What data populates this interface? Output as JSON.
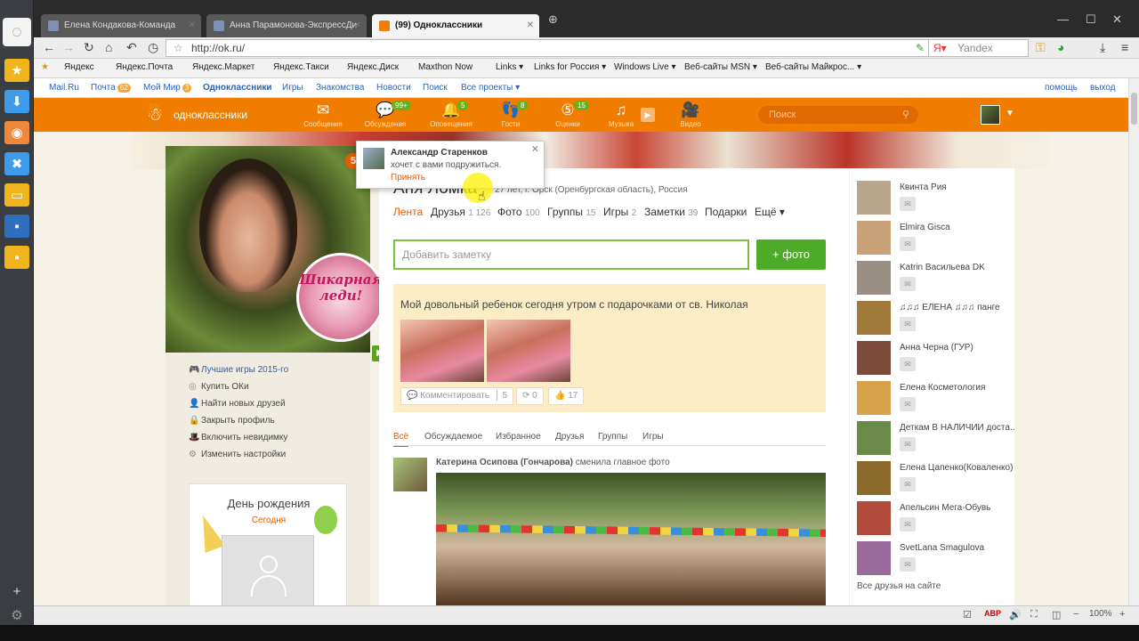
{
  "browser": {
    "tabs": [
      {
        "label": "Елена Кондакова-Команда",
        "fav_color": "#7d90b6"
      },
      {
        "label": "Анна Парамонова-ЭкспрессДи",
        "fav_color": "#7d90b6"
      },
      {
        "label": "(99) Одноклассники",
        "fav_color": "#f07d00"
      }
    ],
    "url": "http://ok.ru/",
    "search_placeholder": "Yandex",
    "bookmarks": [
      "Яндекс",
      "Яндекс.Почта",
      "Яндекс.Маркет",
      "Яндекс.Такси",
      "Яндекс.Диск",
      "Maxthon Now",
      "Links ▾",
      "Links for Россия ▾",
      "Windows Live ▾",
      "Веб-сайты MSN ▾",
      "Веб-сайты Майкрос... ▾"
    ],
    "zoom": "100%"
  },
  "portal": {
    "links": [
      "Mail.Ru",
      "Почта",
      "Мой Мир",
      "Одноклассники",
      "Игры",
      "Знакомства",
      "Новости",
      "Поиск",
      "Все проекты ▾"
    ],
    "mail_count": "62",
    "mir_count": "3",
    "help": "помощь",
    "logout": "выход"
  },
  "toolbar": {
    "logo": "одноклассники",
    "items": [
      {
        "label": "Сообщения",
        "icon": "envelope-icon",
        "glyph": "✉",
        "count": ""
      },
      {
        "label": "Обсуждения",
        "icon": "chat-icon",
        "glyph": "💬",
        "count": "99+"
      },
      {
        "label": "Оповещения",
        "icon": "bell-icon",
        "glyph": "🔔",
        "count": "5"
      },
      {
        "label": "Гости",
        "icon": "footprints-icon",
        "glyph": "👣",
        "count": "8"
      },
      {
        "label": "Оценки",
        "icon": "rating-icon",
        "glyph": "⑤",
        "count": "15"
      },
      {
        "label": "Музыка",
        "icon": "music-icon",
        "glyph": "♫",
        "count": ""
      },
      {
        "label": "Видео",
        "icon": "video-icon",
        "glyph": "🎥",
        "count": ""
      }
    ],
    "search_placeholder": "Поиск"
  },
  "profile": {
    "name": "Аня Ломка",
    "meta": "27 лет, г. Орск (Оренбургская область), Россия",
    "sticker": "Шикарная леди!",
    "tabs": [
      {
        "label": "Лента",
        "count": ""
      },
      {
        "label": "Друзья",
        "count": "1 126"
      },
      {
        "label": "Фото",
        "count": "100"
      },
      {
        "label": "Группы",
        "count": "15"
      },
      {
        "label": "Игры",
        "count": "2"
      },
      {
        "label": "Заметки",
        "count": "39"
      },
      {
        "label": "Подарки",
        "count": ""
      },
      {
        "label": "Ещё ▾",
        "count": ""
      }
    ]
  },
  "left_menu": [
    {
      "label": "Лучшие игры 2015-го",
      "icon": "gamepad-icon",
      "glyph": "🎮"
    },
    {
      "label": "Купить ОКи",
      "icon": "coin-icon",
      "glyph": "◎"
    },
    {
      "label": "Найти новых друзей",
      "icon": "person-icon",
      "glyph": "👤"
    },
    {
      "label": "Закрыть профиль",
      "icon": "lock-icon",
      "glyph": "🔒"
    },
    {
      "label": "Включить невидимку",
      "icon": "hat-icon",
      "glyph": "🎩"
    },
    {
      "label": "Изменить настройки",
      "icon": "gear-icon",
      "glyph": "⚙"
    }
  ],
  "birthday": {
    "title": "День рождения",
    "subtitle": "Сегодня"
  },
  "note": {
    "placeholder": "Добавить заметку",
    "photo_button": "+ фото"
  },
  "post": {
    "text": "Мой довольный ребенок сегодня утром с подарочками от св. Николая",
    "comment_label": "Комментировать",
    "comment_count": "5",
    "reshare_count": "0",
    "like_count": "17"
  },
  "feed_tabs": [
    "Всё",
    "Обсуждаемое",
    "Избранное",
    "Друзья",
    "Группы",
    "Игры"
  ],
  "feed_item": {
    "author": "Катерина Осипова (Гончарова)",
    "action": "сменила главное фото"
  },
  "friends": [
    {
      "name": "Квинта Рия",
      "color": "#b8a58b"
    },
    {
      "name": "Elmira Gisca",
      "color": "#c9a27a"
    },
    {
      "name": "Katrin Васильева DK",
      "color": "#9a8f84"
    },
    {
      "name": "♫♫♫ ЕЛЕНА ♫♫♫ панге",
      "color": "#a07a3a"
    },
    {
      "name": "Анна Черна (ГУР)",
      "color": "#7b4a3a"
    },
    {
      "name": "Елена Косметология",
      "color": "#d6a24a"
    },
    {
      "name": "Деткам В НАЛИЧИИ доста...",
      "color": "#6a8a4a"
    },
    {
      "name": "Елена Цапенко(Коваленко)",
      "color": "#8a6a2a"
    },
    {
      "name": "Апельсин Мега-Обувь",
      "color": "#b04a3a"
    },
    {
      "name": "SvetLana Smagulova",
      "color": "#9a6a9a"
    }
  ],
  "all_friends": "Все друзья на сайте",
  "popup": {
    "name": "Александр Старенков",
    "message": "хочет с вами подружиться.",
    "accept": "Принять"
  }
}
